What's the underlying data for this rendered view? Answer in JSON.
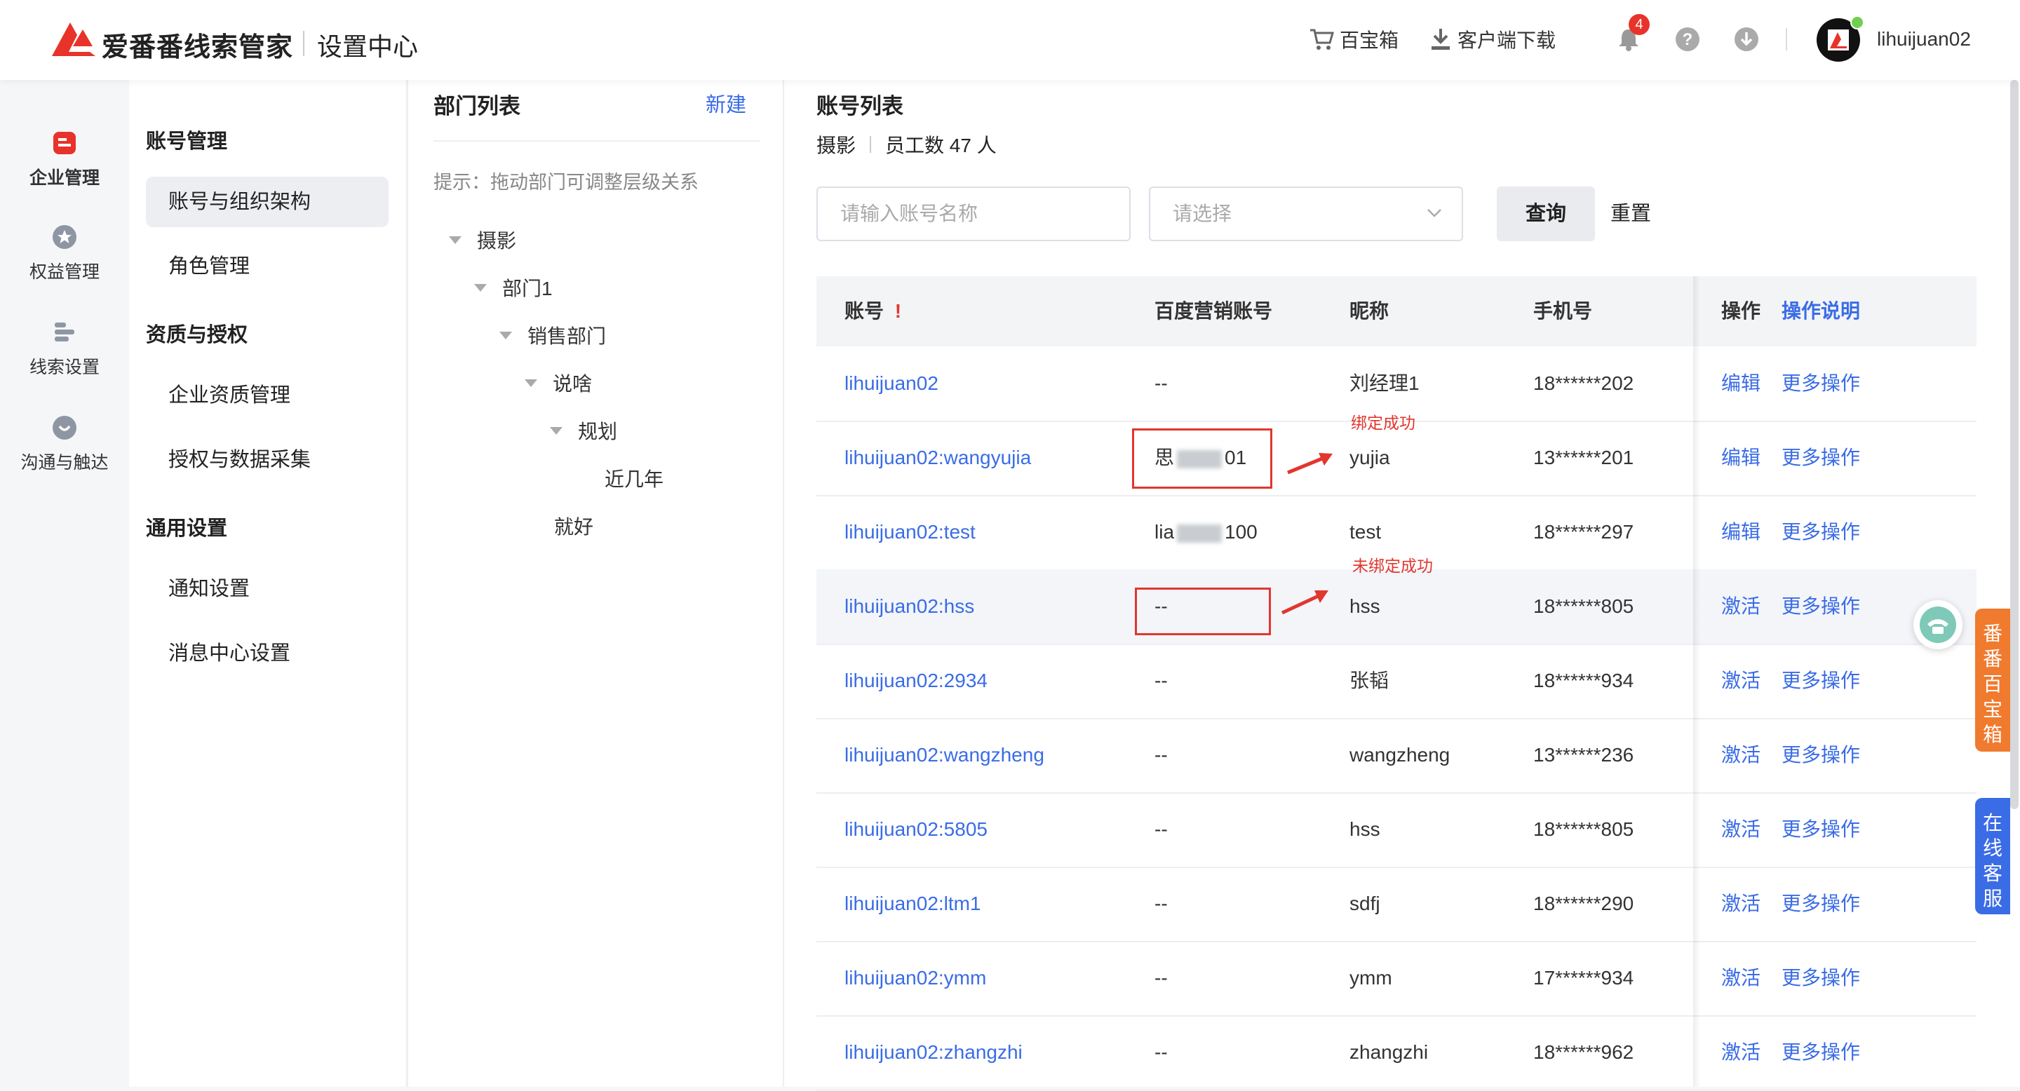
{
  "header": {
    "brand": "爱番番线索管家",
    "subtitle": "设置中心",
    "toolbox": "百宝箱",
    "download": "客户端下载",
    "notification_count": "4",
    "username": "lihuijuan02"
  },
  "rail": [
    {
      "label": "企业管理",
      "icon": "enterprise-icon"
    },
    {
      "label": "权益管理",
      "icon": "rights-icon"
    },
    {
      "label": "线索设置",
      "icon": "leads-icon"
    },
    {
      "label": "沟通与触达",
      "icon": "chat-icon"
    }
  ],
  "menu": {
    "groups": [
      {
        "title": "账号管理",
        "items": [
          "账号与组织架构",
          "角色管理"
        ]
      },
      {
        "title": "资质与授权",
        "items": [
          "企业资质管理",
          "授权与数据采集"
        ]
      },
      {
        "title": "通用设置",
        "items": [
          "通知设置",
          "消息中心设置"
        ]
      }
    ]
  },
  "dept": {
    "title": "部门列表",
    "new_label": "新建",
    "hint": "提示：拖动部门可调整层级关系",
    "tree": [
      "摄影",
      "部门1",
      "销售部门",
      "说啥",
      "规划",
      "近几年",
      "就好"
    ]
  },
  "main": {
    "title": "账号列表",
    "crumb_dept": "摄影",
    "crumb_count": "员工数 47 人",
    "search_placeholder": "请输入账号名称",
    "select_placeholder": "请选择",
    "query_label": "查询",
    "reset_label": "重置",
    "columns": {
      "account": "账号",
      "account_mark": "!",
      "baidu": "百度营销账号",
      "nickname": "昵称",
      "phone": "手机号",
      "ops": "操作",
      "ops_help": "操作说明"
    },
    "rows": [
      {
        "account": "lihuijuan02",
        "baidu": "--",
        "nickname": "刘经理1",
        "phone": "18******202",
        "action": "编辑",
        "more": "更多操作"
      },
      {
        "account": "lihuijuan02:wangyujia",
        "baidu_prefix": "思",
        "baidu_suffix": "01",
        "nickname": "yujia",
        "phone": "13******201",
        "action": "编辑",
        "more": "更多操作"
      },
      {
        "account": "lihuijuan02:test",
        "baidu_prefix": "lia",
        "baidu_suffix": "100",
        "nickname": "test",
        "phone": "18******297",
        "action": "编辑",
        "more": "更多操作"
      },
      {
        "account": "lihuijuan02:hss",
        "baidu": "--",
        "nickname": "hss",
        "phone": "18******805",
        "action": "激活",
        "more": "更多操作"
      },
      {
        "account": "lihuijuan02:2934",
        "baidu": "--",
        "nickname": "张韬",
        "phone": "18******934",
        "action": "激活",
        "more": "更多操作"
      },
      {
        "account": "lihuijuan02:wangzheng",
        "baidu": "--",
        "nickname": "wangzheng",
        "phone": "13******236",
        "action": "激活",
        "more": "更多操作"
      },
      {
        "account": "lihuijuan02:5805",
        "baidu": "--",
        "nickname": "hss",
        "phone": "18******805",
        "action": "激活",
        "more": "更多操作"
      },
      {
        "account": "lihuijuan02:ltm1",
        "baidu": "--",
        "nickname": "sdfj",
        "phone": "18******290",
        "action": "激活",
        "more": "更多操作"
      },
      {
        "account": "lihuijuan02:ymm",
        "baidu": "--",
        "nickname": "ymm",
        "phone": "17******934",
        "action": "激活",
        "more": "更多操作"
      },
      {
        "account": "lihuijuan02:zhangzhi",
        "baidu": "--",
        "nickname": "zhangzhi",
        "phone": "18******962",
        "action": "激活",
        "more": "更多操作"
      }
    ],
    "annotations": {
      "bound": "绑定成功",
      "unbound": "未绑定成功"
    }
  },
  "side_tabs": {
    "toolbox": "番番百宝箱",
    "service": "在线客服"
  },
  "colors": {
    "brand_red": "#e8332a",
    "link_blue": "#3a6ce6",
    "toolbox_orange": "#f07a2e",
    "service_blue": "#3a6ce6"
  }
}
